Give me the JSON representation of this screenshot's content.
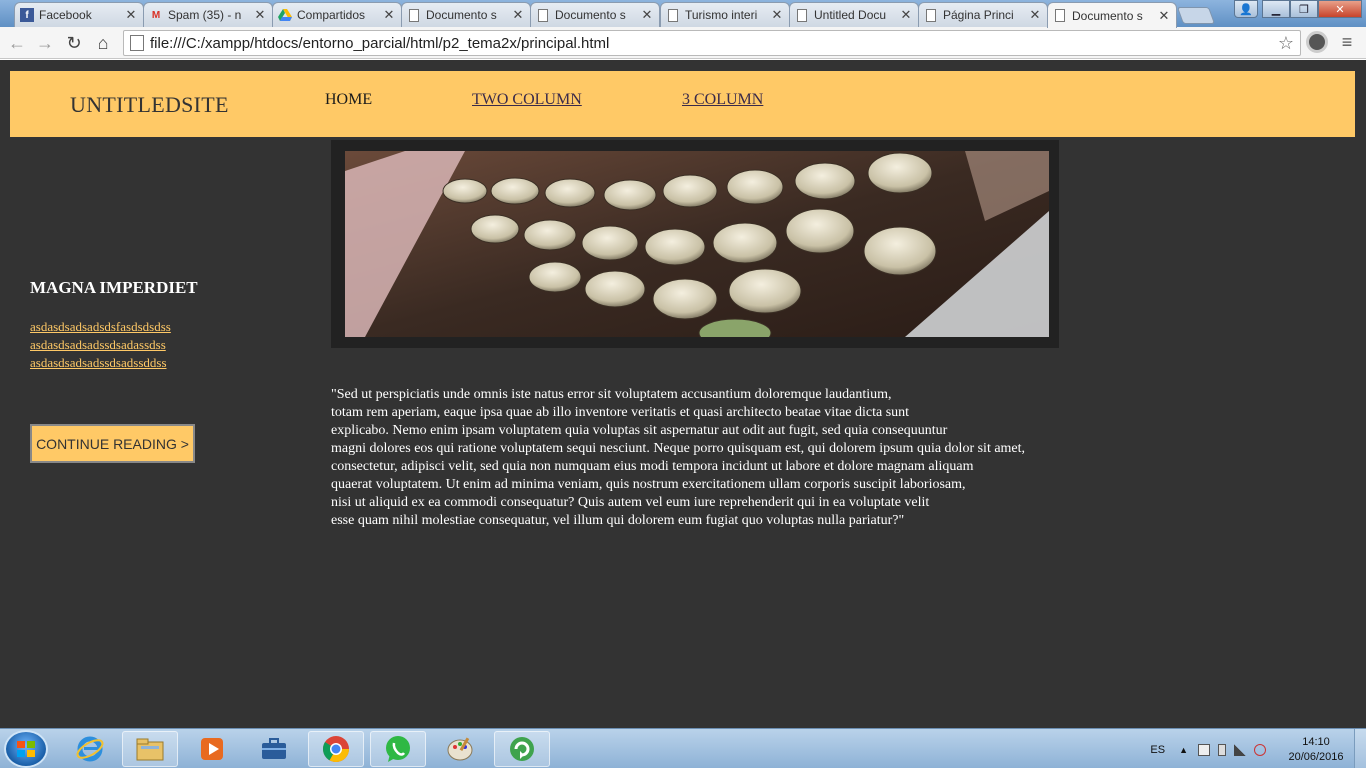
{
  "browser": {
    "tabs": [
      {
        "title": "Facebook",
        "icon": "facebook-icon",
        "color": "#3b5998"
      },
      {
        "title": "Spam (35) - n",
        "icon": "gmail-icon",
        "color": "#d93025"
      },
      {
        "title": "Compartidos",
        "icon": "drive-icon",
        "color": "#1fa463"
      },
      {
        "title": "Documento s",
        "icon": "page-icon",
        "color": "#777777"
      },
      {
        "title": "Documento s",
        "icon": "page-icon",
        "color": "#777777"
      },
      {
        "title": "Turismo interi",
        "icon": "page-icon",
        "color": "#777777"
      },
      {
        "title": "Untitled Docu",
        "icon": "page-icon",
        "color": "#777777"
      },
      {
        "title": "Página Princi",
        "icon": "page-icon",
        "color": "#777777"
      },
      {
        "title": "Documento s",
        "icon": "page-icon",
        "color": "#777777",
        "active": true
      }
    ],
    "url": "file:///C:/xampp/htdocs/entorno_parcial/html/p2_tema2x/principal.html"
  },
  "site": {
    "logo": "UNTITLEDSITE",
    "nav": [
      "HOME",
      "TWO COLUMN",
      "3 COLUMN"
    ],
    "sidebar": {
      "title": "MAGNA IMPERDIET",
      "links": [
        "asdasdsadsadsdsfasdsdsdss",
        "asdasdsadsadssdsadassdss",
        "asdasdsadsadssdsadssddss"
      ],
      "cta": "CONTINUE READING >"
    },
    "body_lines": [
      "\"Sed ut perspiciatis unde omnis iste natus error sit voluptatem accusantium doloremque laudantium,",
      "totam rem aperiam, eaque ipsa quae ab illo inventore veritatis et quasi architecto beatae vitae dicta sunt",
      "explicabo. Nemo enim ipsam voluptatem quia voluptas sit aspernatur aut odit aut fugit, sed quia consequuntur",
      "magni dolores eos qui ratione voluptatem sequi nesciunt. Neque porro quisquam est, qui dolorem ipsum quia dolor sit amet,",
      "consectetur, adipisci velit, sed quia non numquam eius modi tempora incidunt ut labore et dolore magnam aliquam",
      "quaerat voluptatem. Ut enim ad minima veniam, quis nostrum exercitationem ullam corporis suscipit laboriosam,",
      "nisi ut aliquid ex ea commodi consequatur? Quis autem vel eum iure reprehenderit qui in ea voluptate velit",
      "esse quam nihil molestiae consequatur, vel illum qui dolorem eum fugiat quo voluptas nulla pariatur?\""
    ],
    "colors": {
      "accent": "#ffc966",
      "background": "#333333"
    }
  },
  "taskbar": {
    "apps": [
      "internet-explorer-icon",
      "file-explorer-icon",
      "media-player-icon",
      "briefcase-icon",
      "chrome-icon",
      "whatsapp-icon",
      "paint-icon",
      "refresh-app-icon"
    ],
    "lang": "ES",
    "time": "14:10",
    "date": "20/06/2016"
  }
}
